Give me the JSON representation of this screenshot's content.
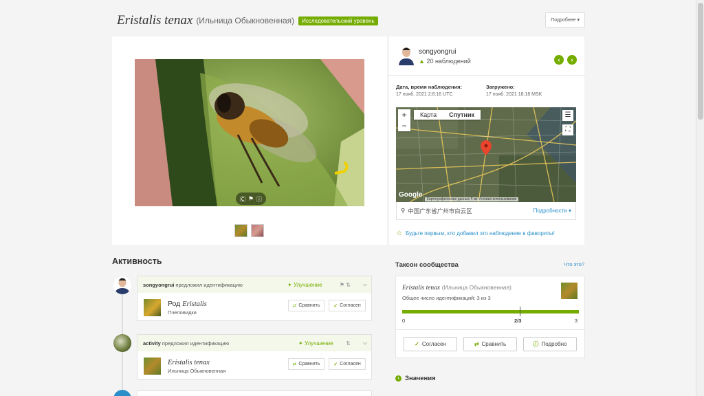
{
  "header": {
    "sci_name": "Eristalis tenax",
    "common_name": "(Ильница Обыкновенная)",
    "grade": "Исследовательский уровень",
    "tools_label": "Подробнее ▾"
  },
  "photo": {
    "badges": [
      "Ⓒ",
      "⚑",
      "ⓘ"
    ]
  },
  "observer": {
    "name": "songyongrui",
    "observations": "20 наблюдений",
    "prev_label": "‹",
    "next_label": "›"
  },
  "meta": {
    "observed_label": "Дата, время наблюдения:",
    "observed_value": "17 нояб. 2021 2:8:16 UTC",
    "uploaded_label": "Загружено:",
    "uploaded_value": "17 нояб. 2021 18:18 MSK"
  },
  "map": {
    "type_map": "Карта",
    "type_satellite": "Спутник",
    "zoom_in": "+",
    "zoom_out": "−",
    "google": "Google",
    "attribution": "Картографические данные   5 км   Условия использования",
    "location": "中国广东省广州市白云区",
    "details_link": "Подробности ▾"
  },
  "favorite_text": "Будьте первым, кто добавил это наблюдение в фавориты!",
  "activity": {
    "title": "Активность",
    "items": [
      {
        "user": "songyongrui",
        "action": "предложил идентификацию",
        "badge": "Улучшение",
        "taxon_rank": "Род",
        "taxon_name": "Eristalis",
        "taxon_common": "Пчеловидки",
        "compare": "Сравнить",
        "agree": "Согласен"
      },
      {
        "user": "activity",
        "action": "предложил идентификацию",
        "badge": "Улучшение",
        "taxon_rank": "",
        "taxon_name": "Eristalis tenax",
        "taxon_common": "Ильница Обыкновенная",
        "compare": "Сравнить",
        "agree": "Согласен"
      }
    ]
  },
  "community_taxon": {
    "title": "Таксон сообщества",
    "what_link": "Что это?",
    "sci_name": "Eristalis tenax",
    "common_name": "(Ильница Обыкновенная)",
    "count_text": "Общее число идентификаций: 3 из 3",
    "agree_fraction": 1.0,
    "label_min": "0",
    "label_mid": "2/3",
    "label_max": "3",
    "btn_agree": "Согласен",
    "btn_compare": "Сравнить",
    "btn_details": "Подробно"
  },
  "values_title": "Значения",
  "colors": {
    "accent": "#74ac00",
    "link": "#2b8fc9"
  }
}
